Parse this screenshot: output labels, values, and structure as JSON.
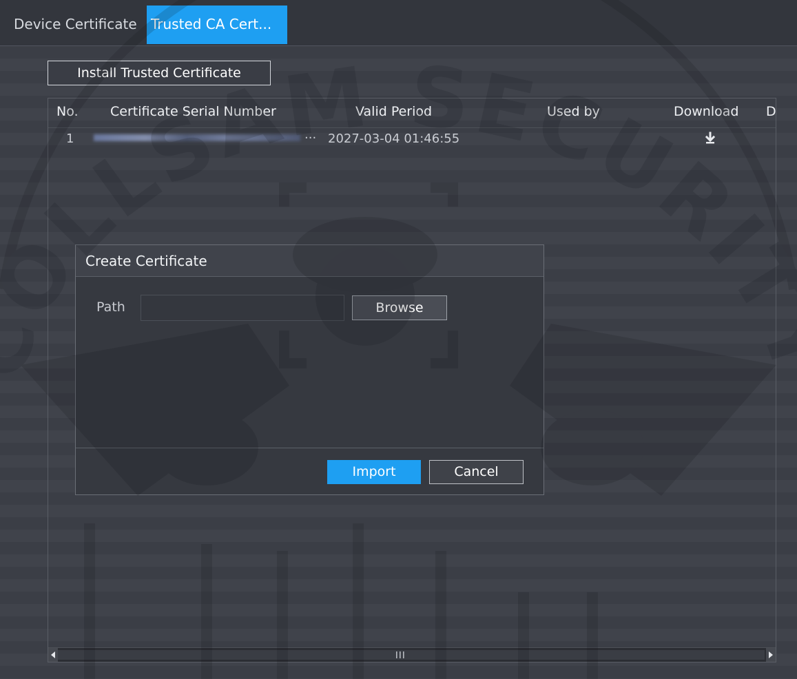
{
  "tabs": [
    {
      "label": "Device Certificate",
      "active": false
    },
    {
      "label": "Trusted CA Cert...",
      "active": true
    }
  ],
  "install_button": "Install Trusted Certificate",
  "table": {
    "columns": {
      "no": "No.",
      "serial": "Certificate Serial Number",
      "valid": "Valid Period",
      "used_by": "Used by",
      "download": "Download",
      "more": "D"
    },
    "rows": [
      {
        "no": "1",
        "serial_suffix": "...",
        "valid": "2027-03-04 01:46:55",
        "used_by": "",
        "download_icon": "download-icon"
      }
    ]
  },
  "dialog": {
    "title": "Create Certificate",
    "path_label": "Path",
    "path_value": "",
    "browse": "Browse",
    "import": "Import",
    "cancel": "Cancel"
  },
  "watermark": {
    "text": "COLLSAM SECURITY"
  },
  "colors": {
    "accent": "#1e9ff2",
    "background": "#3a3d45"
  }
}
